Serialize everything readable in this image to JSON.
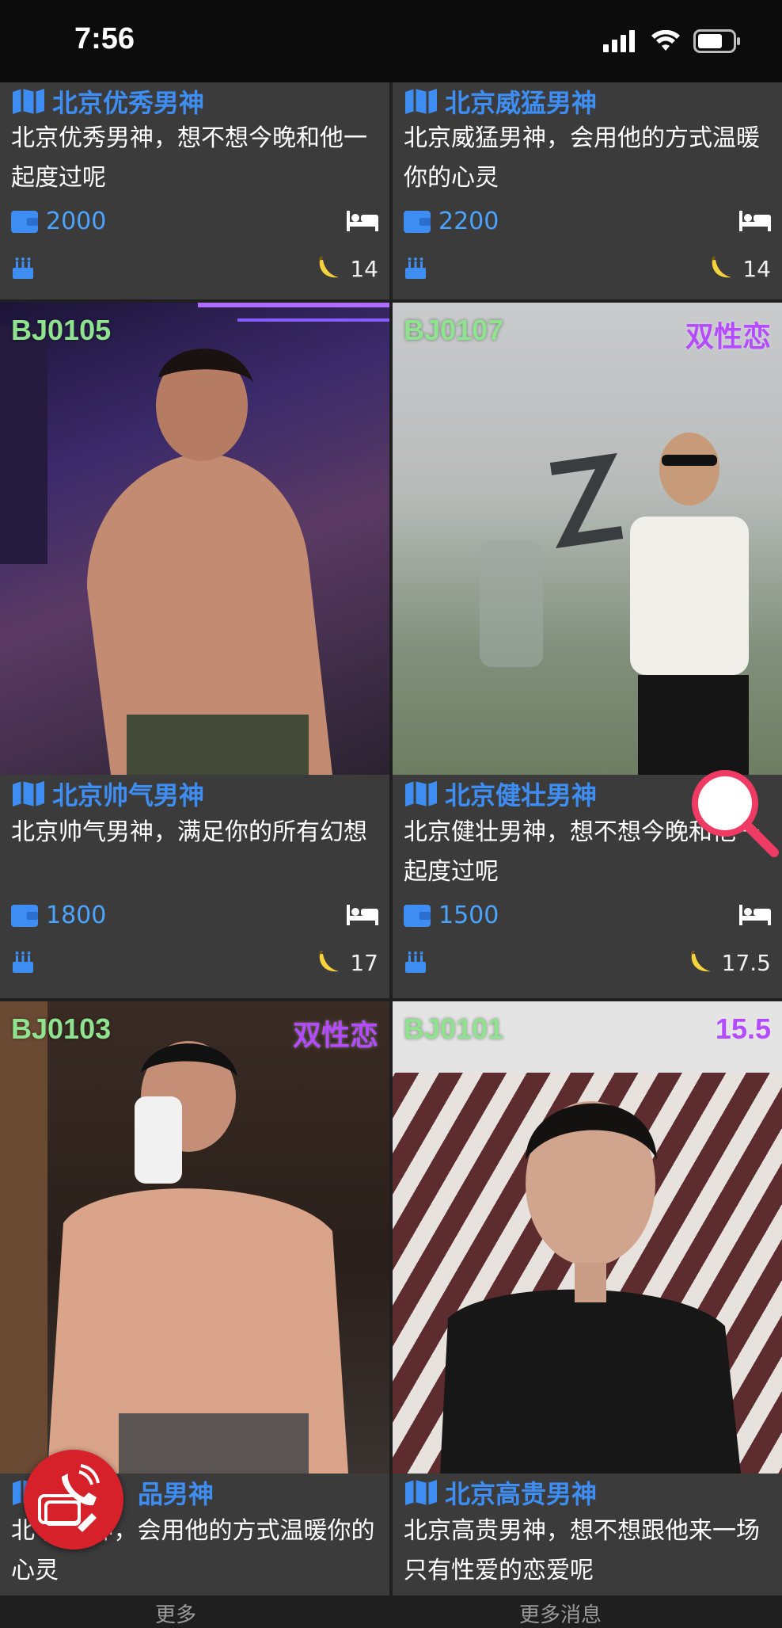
{
  "status": {
    "time": "7:56",
    "icons": [
      "signal-icon",
      "wifi-icon",
      "battery-icon"
    ]
  },
  "cards": [
    {
      "title": "北京优秀男神",
      "desc": "北京优秀男神，想不想今晚和他一起度过呢",
      "price": "2000",
      "count": "14",
      "code": "",
      "tag": ""
    },
    {
      "title": "北京威猛男神",
      "desc": "北京威猛男神，会用他的方式温暖你的心灵",
      "price": "2200",
      "count": "14",
      "code": "",
      "tag": ""
    },
    {
      "code": "BJ0105",
      "tag": "",
      "title": "北京帅气男神",
      "desc": "北京帅气男神，满足你的所有幻想",
      "price": "1800",
      "count": "17"
    },
    {
      "code": "BJ0107",
      "tag": "双性恋",
      "title": "北京健壮男神",
      "desc": "北京健壮男神，想不想今晚和他一起度过呢",
      "price": "1500",
      "count": "17.5"
    },
    {
      "code": "BJ0103",
      "tag": "双性恋",
      "title": "品男神",
      "desc": "北 品男神，会用他的方式温暖你的心灵",
      "price": "",
      "count": ""
    },
    {
      "code": "BJ0101",
      "tag": "15.5",
      "title": "北京高贵男神",
      "desc": "北京高贵男神，想不想跟他来一场只有性爱的恋爱呢",
      "price": "",
      "count": ""
    }
  ],
  "colors": {
    "accent": "#3d8df2",
    "code": "#8fe38f",
    "tag": "#b44bff",
    "fab": "#d6202a"
  },
  "bottom": {
    "left": "更多",
    "right": "更多消息"
  }
}
